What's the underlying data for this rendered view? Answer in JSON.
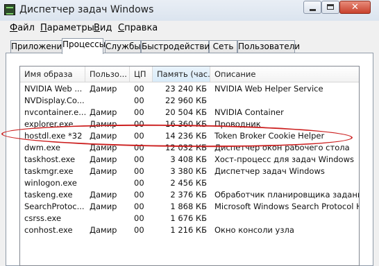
{
  "window": {
    "title": "Диспетчер задач Windows",
    "close_glyph": "✕"
  },
  "menu": [
    "Файл",
    "Параметры",
    "Вид",
    "Справка"
  ],
  "tabs": [
    "Приложения",
    "Процессы",
    "Службы",
    "Быстродействие",
    "Сеть",
    "Пользователи"
  ],
  "active_tab": "Процессы",
  "columns": {
    "name": "Имя образа",
    "user": "Пользо...",
    "cpu": "ЦП",
    "memory": "Память (час...",
    "description": "Описание"
  },
  "processes": [
    {
      "name": "NVIDIA Web ...",
      "user": "Дамир",
      "cpu": "00",
      "memory": "23 240 КБ",
      "description": "NVIDIA Web Helper Service"
    },
    {
      "name": "NVDisplay.Co...",
      "user": "",
      "cpu": "00",
      "memory": "22 960 КБ",
      "description": ""
    },
    {
      "name": "nvcontainer.e...",
      "user": "Дамир",
      "cpu": "00",
      "memory": "20 504 КБ",
      "description": "NVIDIA Container"
    },
    {
      "name": "explorer.exe",
      "user": "Дамир",
      "cpu": "00",
      "memory": "16 360 КБ",
      "description": "Проводник"
    },
    {
      "name": "hostdl.exe *32",
      "user": "Дамир",
      "cpu": "00",
      "memory": "14 236 КБ",
      "description": "Token Broker Cookie Helper"
    },
    {
      "name": "dwm.exe",
      "user": "Дамир",
      "cpu": "00",
      "memory": "12 032 КБ",
      "description": "Диспетчер окон рабочего стола"
    },
    {
      "name": "taskhost.exe",
      "user": "Дамир",
      "cpu": "00",
      "memory": "3 408 КБ",
      "description": "Хост-процесс для задач Windows"
    },
    {
      "name": "taskmgr.exe",
      "user": "Дамир",
      "cpu": "00",
      "memory": "3 380 КБ",
      "description": "Диспетчер задач Windows"
    },
    {
      "name": "winlogon.exe",
      "user": "",
      "cpu": "00",
      "memory": "2 456 КБ",
      "description": ""
    },
    {
      "name": "taskeng.exe",
      "user": "Дамир",
      "cpu": "00",
      "memory": "2 376 КБ",
      "description": "Обработчик планировщика заданий"
    },
    {
      "name": "SearchProtoc...",
      "user": "Дамир",
      "cpu": "00",
      "memory": "1 868 КБ",
      "description": "Microsoft Windows Search Protocol Host"
    },
    {
      "name": "csrss.exe",
      "user": "",
      "cpu": "00",
      "memory": "1 676 КБ",
      "description": ""
    },
    {
      "name": "conhost.exe",
      "user": "Дамир",
      "cpu": "00",
      "memory": "1 216 КБ",
      "description": "Окно консоли узла"
    }
  ],
  "highlight_color": "#cc1f1f"
}
